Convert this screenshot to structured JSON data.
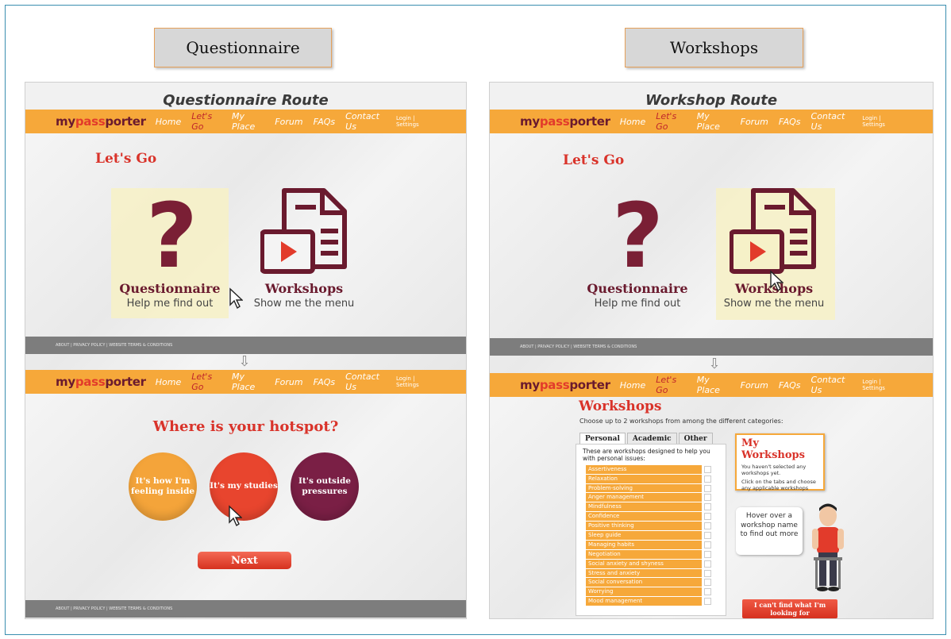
{
  "labels": {
    "left": "Questionnaire",
    "right": "Workshops"
  },
  "nav": {
    "logo": [
      "my",
      "pass",
      "porter"
    ],
    "items": [
      "Home",
      "Let's Go",
      "My Place",
      "Forum",
      "FAQs",
      "Contact Us"
    ],
    "login": "Login | Settings",
    "footer": "ABOUT | PRIVACY POLICY | WEBSITE TERMS & CONDITIONS"
  },
  "left_panel": {
    "route_title": "Questionnaire Route",
    "heading": "Let's Go",
    "question_mark": "?",
    "option1": {
      "title": "Questionnaire",
      "sub": "Help me find out"
    },
    "option2": {
      "title": "Workshops",
      "sub": "Show me the menu"
    },
    "down_arrow": "⇩",
    "hotspot_title": "Where is your hotspot?",
    "circles": [
      "It's how I'm feeling inside",
      "It's my studies",
      "It's outside pressures"
    ],
    "next": "Next"
  },
  "right_panel": {
    "route_title": "Workshop Route",
    "heading": "Let's Go",
    "question_mark": "?",
    "option1": {
      "title": "Questionnaire",
      "sub": "Help me find out"
    },
    "option2": {
      "title": "Workshops",
      "sub": "Show me the menu"
    },
    "down_arrow": "⇩",
    "ws_heading": "Workshops",
    "ws_sub": "Choose up to 2 workshops from among the different categories:",
    "tabs": [
      "Personal",
      "Academic",
      "Other"
    ],
    "list_desc": "These are workshops designed to help you with personal issues:",
    "workshops": [
      "Assertiveness",
      "Relaxation",
      "Problem-solving",
      "Anger management",
      "Mindfulness",
      "Confidence",
      "Positive thinking",
      "Sleep guide",
      "Managing habits",
      "Negotiation",
      "Social anxiety and shyness",
      "Stress and anxiety",
      "Social conversation",
      "Worrying",
      "Mood management"
    ],
    "my_ws_title": "My Workshops",
    "my_ws_text1": "You haven't selected any workshops yet.",
    "my_ws_text2": "Click on the tabs and choose any applicable workshops",
    "bubble": "Hover over a workshop name to find out more",
    "cant_find": "I can't find what I'm looking for"
  },
  "colors": {
    "accent": "#f6a83a",
    "brand_red": "#d9332a",
    "brand_maroon": "#6a1a2e"
  }
}
